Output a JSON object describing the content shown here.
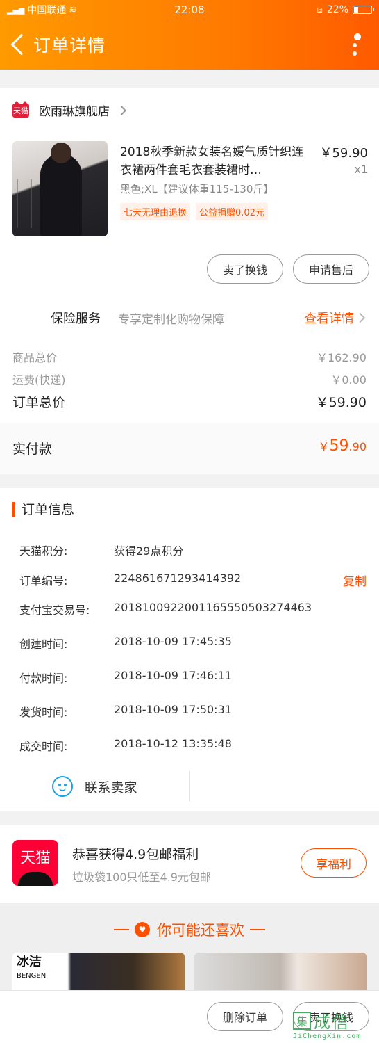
{
  "statusbar": {
    "carrier": "中国联通",
    "time": "22:08",
    "battery": "22%"
  },
  "nav": {
    "title": "订单详情"
  },
  "shop": {
    "badge": "天猫",
    "name": "欧雨琳旗舰店"
  },
  "product": {
    "title": "2018秋季新款女装名媛气质针织连衣裙两件套毛衣套装裙时…",
    "price": "￥59.90",
    "qty": "x1",
    "spec": "黑色;XL【建议体重115-130斤】",
    "tags": [
      "七天无理由退换",
      "公益捐赠0.02元"
    ]
  },
  "actions": {
    "sell_exchange": "卖了换钱",
    "after_sale": "申请售后",
    "delete_order": "删除订单",
    "sell_exchange_bottom": "卖了换钱"
  },
  "insurance": {
    "label": "保险服务",
    "desc": "专享定制化购物保障",
    "link": "查看详情"
  },
  "prices": {
    "goods_label": "商品总价",
    "goods_value": "￥162.90",
    "shipping_label": "运费(快递)",
    "shipping_value": "￥0.00",
    "total_label": "订单总价",
    "total_value": "￥59.90",
    "paid_label": "实付款",
    "paid_symbol": "￥",
    "paid_int": "59",
    "paid_dec": ".90"
  },
  "order_info": {
    "title": "订单信息",
    "rows": [
      {
        "key": "天猫积分:",
        "value": "获得29点积分"
      },
      {
        "key": "订单编号:",
        "value": "224861671293414392",
        "action": "复制"
      },
      {
        "key": "支付宝交易号:",
        "value": "2018100922001165550503274463"
      },
      {
        "key": "创建时间:",
        "value": "2018-10-09 17:45:35"
      },
      {
        "key": "付款时间:",
        "value": "2018-10-09 17:46:11"
      },
      {
        "key": "发货时间:",
        "value": "2018-10-09 17:50:31"
      },
      {
        "key": "成交时间:",
        "value": "2018-10-12 13:35:48"
      }
    ],
    "contact": "联系卖家"
  },
  "promo": {
    "logo_text": "天猫",
    "title": "恭喜获得4.9包邮福利",
    "subtitle": "垃圾袋100只低至4.9元包邮",
    "button": "享福利"
  },
  "recommend": {
    "title": "你可能还喜欢",
    "brand": "冰洁",
    "brand_sub": "BENGEN"
  },
  "watermark": {
    "box": "集",
    "text": "成信",
    "url": "JiChengXin.com"
  }
}
